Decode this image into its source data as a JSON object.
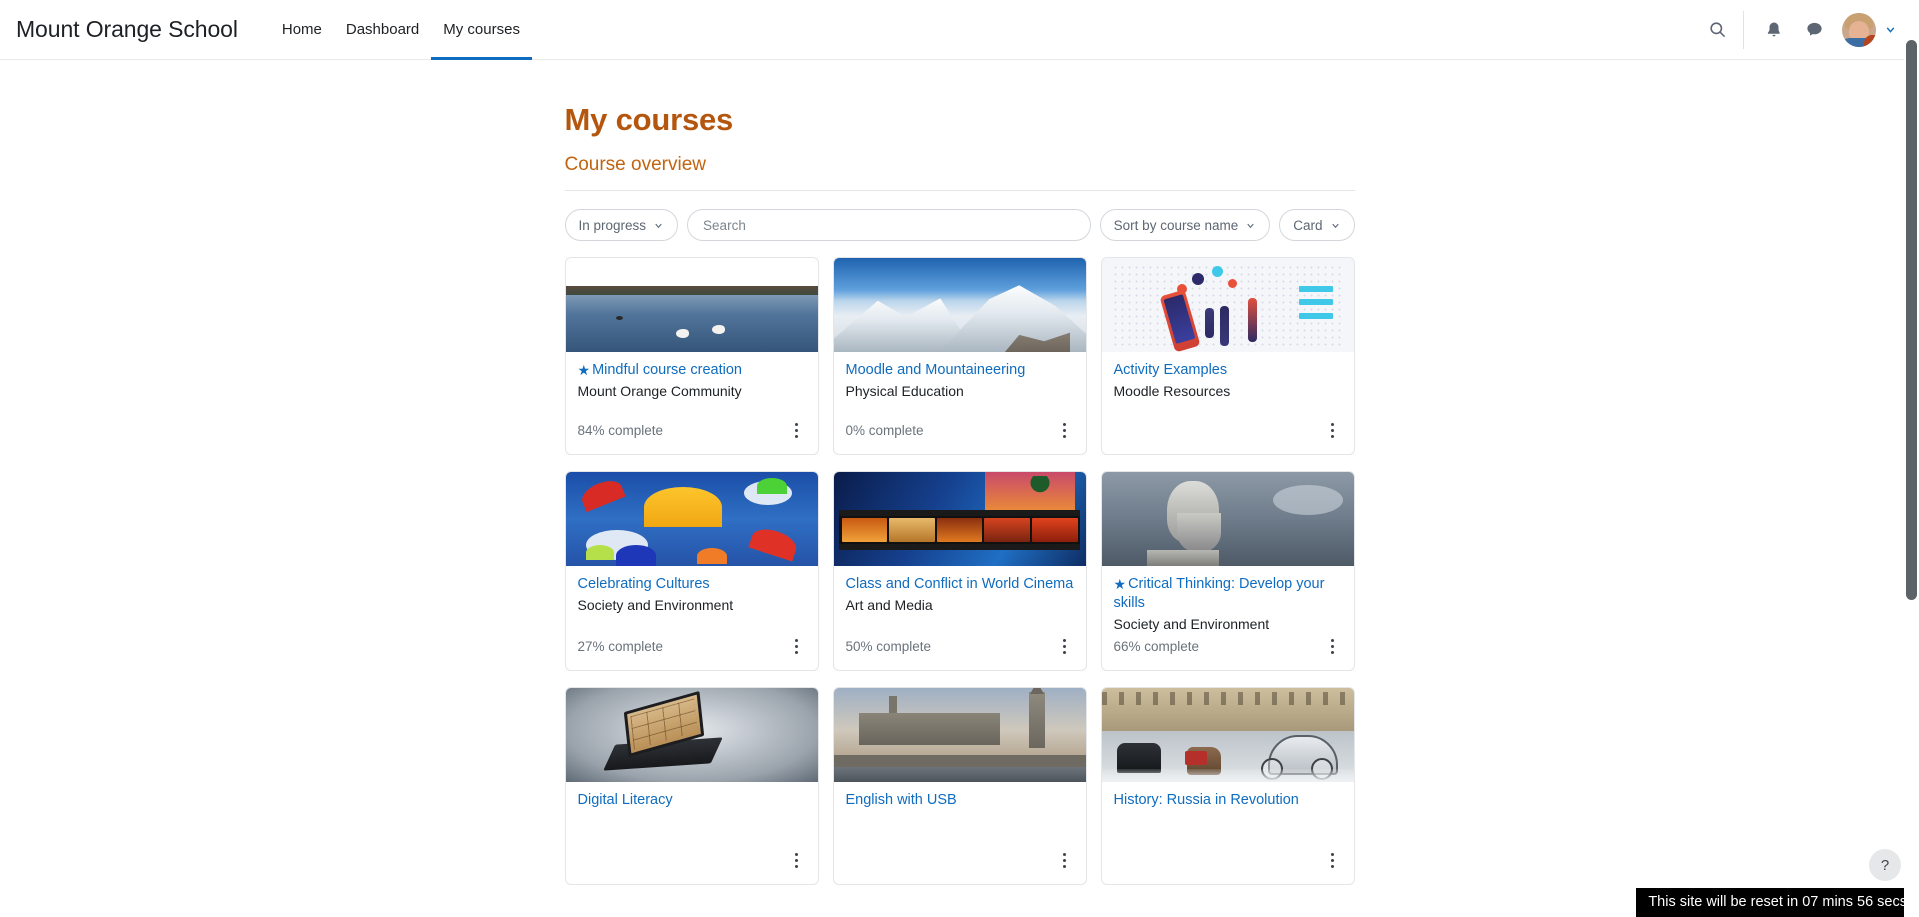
{
  "navbar": {
    "brand": "Mount Orange School",
    "links": [
      {
        "label": "Home",
        "active": false
      },
      {
        "label": "Dashboard",
        "active": false
      },
      {
        "label": "My courses",
        "active": true
      }
    ],
    "icons": {
      "search": "search-icon",
      "notifications": "bell-icon",
      "messages": "message-bubble-icon",
      "avatar": "user-avatar",
      "chevron": "chevron-down-icon"
    }
  },
  "page": {
    "title": "My courses",
    "overview_title": "Course overview"
  },
  "toolbar": {
    "filter": "In progress",
    "search_placeholder": "Search",
    "search_value": "",
    "sort": "Sort by course name",
    "view": "Card"
  },
  "courses": [
    {
      "title": "Mindful course creation",
      "category": "Mount Orange Community",
      "progress": "84% complete",
      "starred": true,
      "art": "art-lake"
    },
    {
      "title": "Moodle and Mountaineering",
      "category": "Physical Education",
      "progress": "0% complete",
      "starred": false,
      "art": "art-mountain"
    },
    {
      "title": "Activity Examples",
      "category": "Moodle Resources",
      "progress": "",
      "starred": false,
      "art": "art-activity"
    },
    {
      "title": "Celebrating Cultures",
      "category": "Society and Environment",
      "progress": "27% complete",
      "starred": false,
      "art": "art-umbrella"
    },
    {
      "title": "Class and Conflict in World Cinema",
      "category": "Art and Media",
      "progress": "50% complete",
      "starred": false,
      "art": "art-film"
    },
    {
      "title": "Critical Thinking: Develop your skills",
      "category": "Society and Environment",
      "progress": "66% complete",
      "starred": true,
      "art": "art-statue"
    },
    {
      "title": "Digital Literacy",
      "category": "",
      "progress": "",
      "starred": false,
      "art": "art-laptop"
    },
    {
      "title": "English with USB",
      "category": "",
      "progress": "",
      "starred": false,
      "art": "art-london"
    },
    {
      "title": "History: Russia in Revolution",
      "category": "",
      "progress": "",
      "starred": false,
      "art": "art-russia"
    }
  ],
  "help_button": "?",
  "toast": "This site will be reset in 07 mins 56 secs",
  "colors": {
    "brand_orange": "#b5560e",
    "subtitle_orange": "#c2640f",
    "link_blue": "#0f6cbf",
    "active_tab": "#0f6cbf",
    "muted_text": "#6a737c",
    "toast_bg": "#000000"
  }
}
